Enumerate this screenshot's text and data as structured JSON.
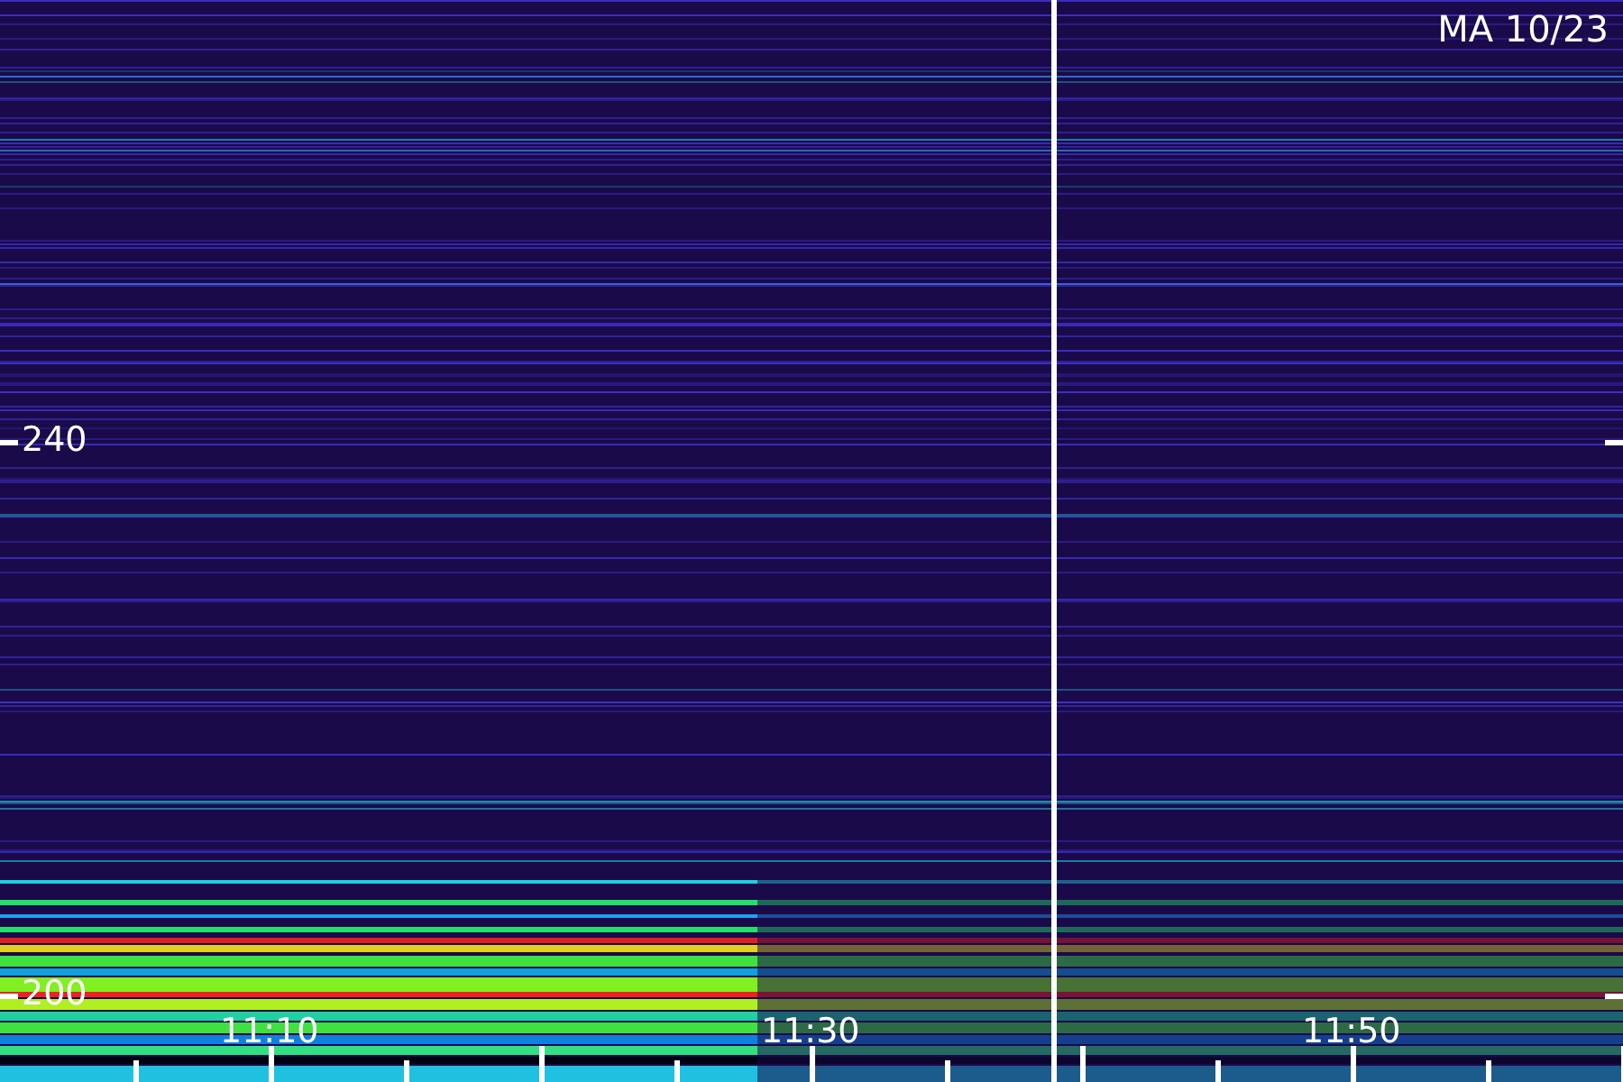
{
  "date_label": "MA 10/23",
  "y_labels": [
    "240",
    "200"
  ],
  "x_labels": [
    "11:10",
    "11:30",
    "11:50"
  ]
}
